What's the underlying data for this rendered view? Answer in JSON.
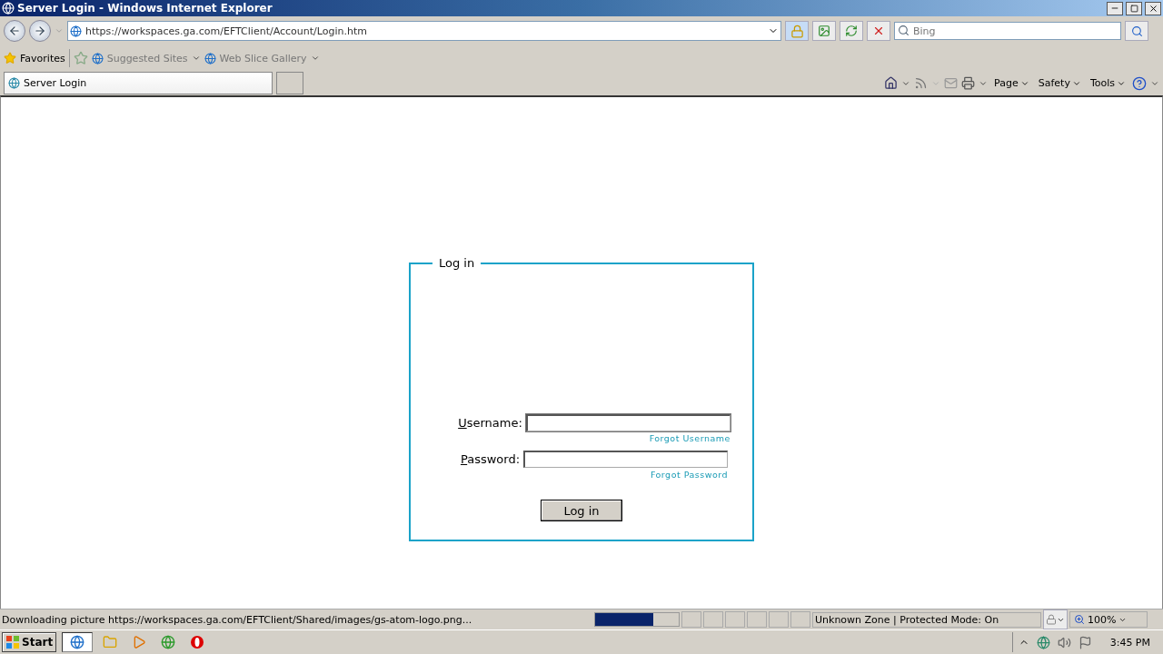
{
  "window": {
    "title": "Server Login - Windows Internet Explorer"
  },
  "address_bar": {
    "url": "https://workspaces.ga.com/EFTClient/Account/Login.htm",
    "search_placeholder": "Bing"
  },
  "favorites_bar": {
    "favorites": "Favorites",
    "links": [
      "Suggested Sites",
      "Web Slice Gallery"
    ]
  },
  "tabs": [
    {
      "label": "Server Login",
      "selected": true
    }
  ],
  "command_bar": {
    "menus": [
      "Page",
      "Safety",
      "Tools"
    ]
  },
  "login": {
    "legend": "Log in",
    "fields": [
      {
        "label": "Username:",
        "link": "Forgot Username",
        "focused": true
      },
      {
        "label": "Password:",
        "link": "Forgot Password",
        "focused": false
      }
    ],
    "button": "Log in"
  },
  "status_bar": {
    "text": "Downloading picture https://workspaces.ga.com/EFTClient/Shared/images/gs-atom-logo.png...",
    "level": 0.7,
    "zone": "Unknown Zone | Protected Mode: On",
    "zoom": "100%"
  },
  "taskbar": {
    "start": "Start",
    "time": "3:45 PM"
  }
}
